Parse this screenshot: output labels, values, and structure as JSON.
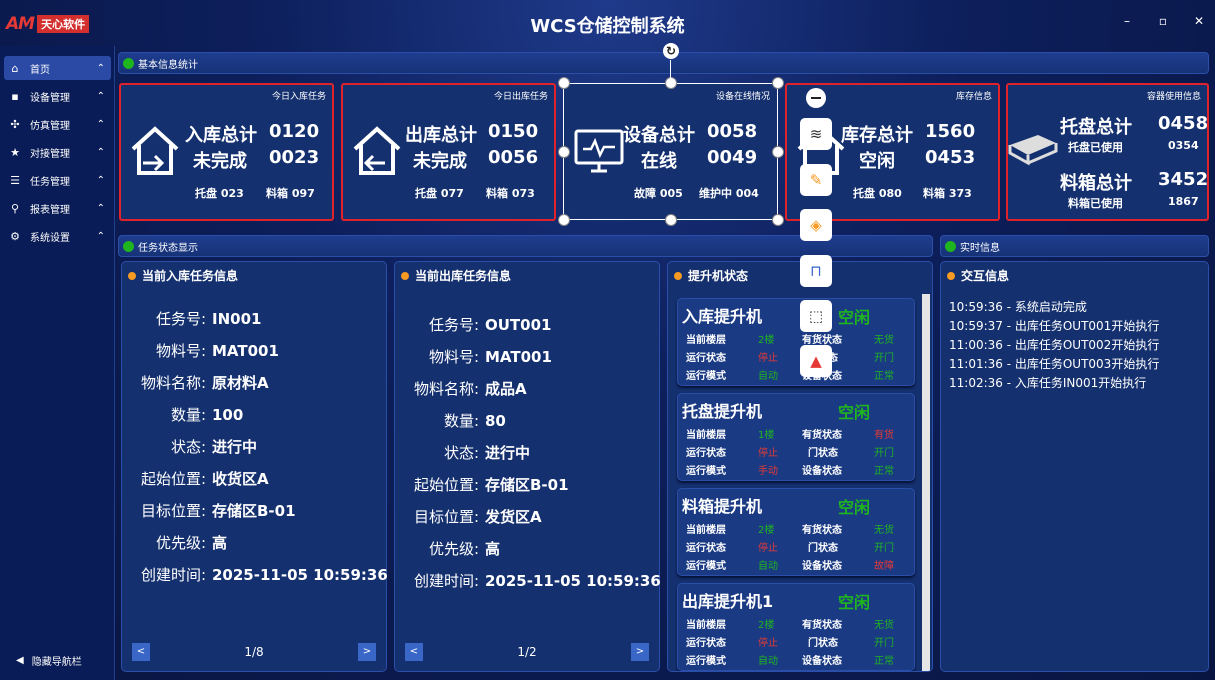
{
  "app": {
    "logo_mark": "AM",
    "logo_name": "天心软件",
    "title": "WCS仓储控制系统"
  },
  "sidebar": {
    "items": [
      {
        "label": "首页",
        "icon": "home-icon"
      },
      {
        "label": "设备管理",
        "icon": "device-icon"
      },
      {
        "label": "仿真管理",
        "icon": "puzzle-icon"
      },
      {
        "label": "对接管理",
        "icon": "star-icon"
      },
      {
        "label": "任务管理",
        "icon": "list-icon"
      },
      {
        "label": "报表管理",
        "icon": "search-icon"
      },
      {
        "label": "系统设置",
        "icon": "gear-icon"
      }
    ],
    "hide_label": "隐藏导航栏"
  },
  "sections": {
    "basic": "基本信息统计",
    "task": "任务状态显示",
    "realtime": "实时信息"
  },
  "cards": {
    "inbound": {
      "title": "今日入库任务",
      "k1": "入库总计",
      "v1": "0120",
      "k2": "未完成",
      "v2": "0023",
      "s1": "托盘 023",
      "s2": "料箱 097"
    },
    "outbound": {
      "title": "今日出库任务",
      "k1": "出库总计",
      "v1": "0150",
      "k2": "未完成",
      "v2": "0056",
      "s1": "托盘 077",
      "s2": "料箱 073"
    },
    "device": {
      "title": "设备在线情况",
      "k1": "设备总计",
      "v1": "0058",
      "k2": "在线",
      "v2": "0049",
      "s1": "故障 005",
      "s2": "维护中 004"
    },
    "stock": {
      "title": "库存信息",
      "k1": "库存总计",
      "v1": "1560",
      "k2": "空闲",
      "v2": "0453",
      "s1": "托盘 080",
      "s2": "料箱 373"
    },
    "container": {
      "title": "容器使用信息",
      "k1": "托盘总计",
      "v1": "0458",
      "s1k": "托盘已使用",
      "s1v": "0354",
      "k2": "料箱总计",
      "v2": "3452",
      "s2k": "料箱已使用",
      "s2v": "1867"
    }
  },
  "inbound_task": {
    "title": "当前入库任务信息",
    "rows": [
      {
        "k": "任务号:",
        "v": "IN001"
      },
      {
        "k": "物料号:",
        "v": "MAT001"
      },
      {
        "k": "物料名称:",
        "v": "原材料A"
      },
      {
        "k": "数量:",
        "v": "100"
      },
      {
        "k": "状态:",
        "v": "进行中"
      },
      {
        "k": "起始位置:",
        "v": "收货区A"
      },
      {
        "k": "目标位置:",
        "v": "存储区B-01"
      },
      {
        "k": "优先级:",
        "v": "高"
      },
      {
        "k": "创建时间:",
        "v": "2025-11-05 10:59:36"
      }
    ],
    "page": "1/8"
  },
  "outbound_task": {
    "title": "当前出库任务信息",
    "rows": [
      {
        "k": "任务号:",
        "v": "OUT001"
      },
      {
        "k": "物料号:",
        "v": "MAT001"
      },
      {
        "k": "物料名称:",
        "v": "成品A"
      },
      {
        "k": "数量:",
        "v": "80"
      },
      {
        "k": "状态:",
        "v": "进行中"
      },
      {
        "k": "起始位置:",
        "v": "存储区B-01"
      },
      {
        "k": "目标位置:",
        "v": "发货区A"
      },
      {
        "k": "优先级:",
        "v": "高"
      },
      {
        "k": "创建时间:",
        "v": "2025-11-05 10:59:36"
      }
    ],
    "page": "1/2"
  },
  "lifts": {
    "title": "提升机状态",
    "items": [
      {
        "name": "入库提升机",
        "status": "空闲",
        "floor_k": "当前楼层",
        "floor_v": "2楼",
        "run_k": "运行状态",
        "run_v": "停止",
        "mode_k": "运行模式",
        "mode_v": "自动",
        "cargo_k": "有货状态",
        "cargo_v": "无货",
        "door_k": "门状态",
        "door_v": "开门",
        "dev_k": "设备状态",
        "dev_v": "正常"
      },
      {
        "name": "托盘提升机",
        "status": "空闲",
        "floor_k": "当前楼层",
        "floor_v": "1楼",
        "run_k": "运行状态",
        "run_v": "停止",
        "mode_k": "运行模式",
        "mode_v": "手动",
        "cargo_k": "有货状态",
        "cargo_v": "有货",
        "door_k": "门状态",
        "door_v": "开门",
        "dev_k": "设备状态",
        "dev_v": "正常"
      },
      {
        "name": "料箱提升机",
        "status": "空闲",
        "floor_k": "当前楼层",
        "floor_v": "2楼",
        "run_k": "运行状态",
        "run_v": "停止",
        "mode_k": "运行模式",
        "mode_v": "自动",
        "cargo_k": "有货状态",
        "cargo_v": "无货",
        "door_k": "门状态",
        "door_v": "开门",
        "dev_k": "设备状态",
        "dev_v": "故障"
      },
      {
        "name": "出库提升机1",
        "status": "空闲",
        "floor_k": "当前楼层",
        "floor_v": "2楼",
        "run_k": "运行状态",
        "run_v": "停止",
        "mode_k": "运行模式",
        "mode_v": "自动",
        "cargo_k": "有货状态",
        "cargo_v": "无货",
        "door_k": "门状态",
        "door_v": "开门",
        "dev_k": "设备状态",
        "dev_v": "正常"
      }
    ]
  },
  "interaction": {
    "title": "交互信息",
    "logs": [
      "10:59:36 - 系统启动完成",
      "10:59:37 - 出库任务OUT001开始执行",
      "11:00:36 - 出库任务OUT002开始执行",
      "11:01:36 - 出库任务OUT003开始执行",
      "11:02:36 - 入库任务IN001开始执行"
    ]
  },
  "toolbar": {
    "icons": [
      "minus-icon",
      "layers-icon",
      "brush-icon",
      "fill-icon",
      "frame-icon",
      "shape-icon",
      "logo-app-icon"
    ]
  },
  "colors": {
    "ok": "#1fb51f",
    "alert": "#e53935",
    "accent": "#f59a23",
    "border": "#e0232b"
  }
}
